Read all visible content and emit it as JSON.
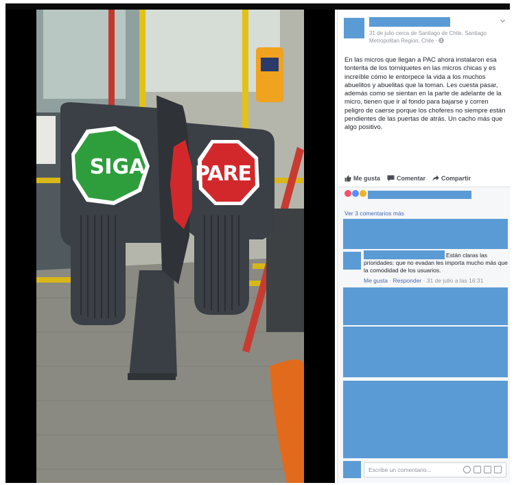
{
  "post": {
    "meta": "31 de julio cerca de Santiago de Chile, Santiago Metropolitan Region, Chile · ",
    "text": "En las micros que llegan a PAC ahora instalaron esa tonterita de los torniquetes en las micros chicas y es increíble cómo le entorpece la vida a los muchos abuelitos y abuelitas que la toman. Les cuesta pasar, además como se sientan en la parte de adelante de la micro, tienen que ir al fondo para bajarse y corren peligro de caerse porque los choferes no siempre están pendientes de las puertas de atrás. Un cacho más que algo positivo."
  },
  "actions": {
    "like": "Me gusta",
    "comment": "Comentar",
    "share": "Compartir"
  },
  "comments": {
    "view_more": "Ver 3 comentarios más",
    "c2": {
      "text": "Están claras las prioridades: que no evadan les importa mucho más que la comodidad de los usuarios.",
      "like": "Me gusta",
      "reply": "Responder",
      "date": "31 de julio a las 16:31"
    },
    "composer_placeholder": "Escribe un comentario..."
  },
  "photo": {
    "sign_go": "SIGA",
    "sign_stop": "PARE"
  },
  "colors": {
    "accent": "#4267b2",
    "redaction": "#5b9bd5",
    "sign_green": "#2e9e3d",
    "sign_red": "#d3282b"
  },
  "icons": [
    "chevron-down-icon",
    "globe-icon",
    "thumbs-up-icon",
    "comment-icon",
    "share-icon",
    "emoji-icon",
    "camera-icon",
    "gif-icon",
    "sticker-icon"
  ]
}
